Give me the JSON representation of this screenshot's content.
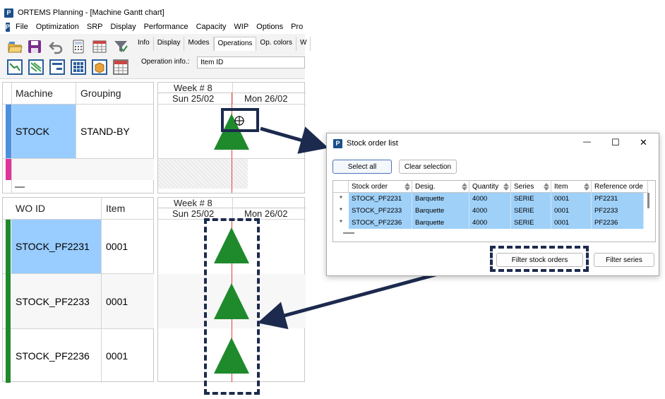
{
  "window": {
    "app_badge": "P",
    "title": "ORTEMS  Planning - [Machine Gantt chart]"
  },
  "menu": [
    "File",
    "Optimization",
    "SRP",
    "Display",
    "Performance",
    "Capacity",
    "WIP",
    "Options",
    "Pro"
  ],
  "toolbar": {
    "icons": [
      "open-folder-icon",
      "save-icon",
      "undo-icon",
      "calculator-icon",
      "table-edit-icon",
      "filter-icon",
      "gantt-chart-icon",
      "multi-gantt-icon",
      "panel-icon",
      "grid-icon",
      "package-icon",
      "grid-red-icon"
    ],
    "tabs": [
      "Info",
      "Display",
      "Modes",
      "Operations",
      "Op. colors",
      "W"
    ],
    "active_tab": "Operations",
    "operation_info_label": "Operation info.:",
    "operation_info_value": "Item ID"
  },
  "machine_panel": {
    "headers": [
      "Machine",
      "Grouping"
    ],
    "rows": [
      {
        "machine": "STOCK",
        "grouping": "STAND-BY",
        "color": "#4a90e2"
      },
      {
        "machine": "",
        "grouping": "",
        "color": "#e0339a"
      }
    ],
    "gantt_header": {
      "week": "Week # 8",
      "days": [
        "Sun 25/02",
        "Mon 26/02"
      ]
    }
  },
  "wo_panel": {
    "headers": [
      "WO ID",
      "Item"
    ],
    "rows": [
      {
        "wo_id": "STOCK_PF2231",
        "item": "0001"
      },
      {
        "wo_id": "STOCK_PF2233",
        "item": "0001"
      },
      {
        "wo_id": "STOCK_PF2236",
        "item": "0001"
      }
    ],
    "gantt_header": {
      "week": "Week # 8",
      "days": [
        "Sun 25/02",
        "Mon 26/02"
      ]
    }
  },
  "dialog": {
    "badge": "P",
    "title": "Stock order list",
    "controls": {
      "minimize": "—",
      "maximize": "☐",
      "close": "✕"
    },
    "buttons": {
      "select_all": "Select all",
      "clear_selection": "Clear selection",
      "filter_stock_orders": "Filter stock orders",
      "filter_series": "Filter series"
    },
    "columns": [
      "Stock order",
      "Desig.",
      "Quantity",
      "Series",
      "Item",
      "Reference orde"
    ],
    "rows": [
      {
        "mark": "*",
        "cells": [
          "STOCK_PF2231",
          "Barquette",
          "4000",
          "SERIE",
          "0001",
          "PF2231"
        ]
      },
      {
        "mark": "*",
        "cells": [
          "STOCK_PF2233",
          "Barquette",
          "4000",
          "SERIE",
          "0001",
          "PF2233"
        ]
      },
      {
        "mark": "*",
        "cells": [
          "STOCK_PF2236",
          "Barquette",
          "4000",
          "SERIE",
          "0001",
          "PF2236"
        ]
      }
    ]
  },
  "colors": {
    "selection": "#99ccff",
    "triangle": "#1f8a2c",
    "annotation": "#1c2a4e",
    "wo_bar": "#1f8a2c",
    "today_line": "#e0403a"
  }
}
